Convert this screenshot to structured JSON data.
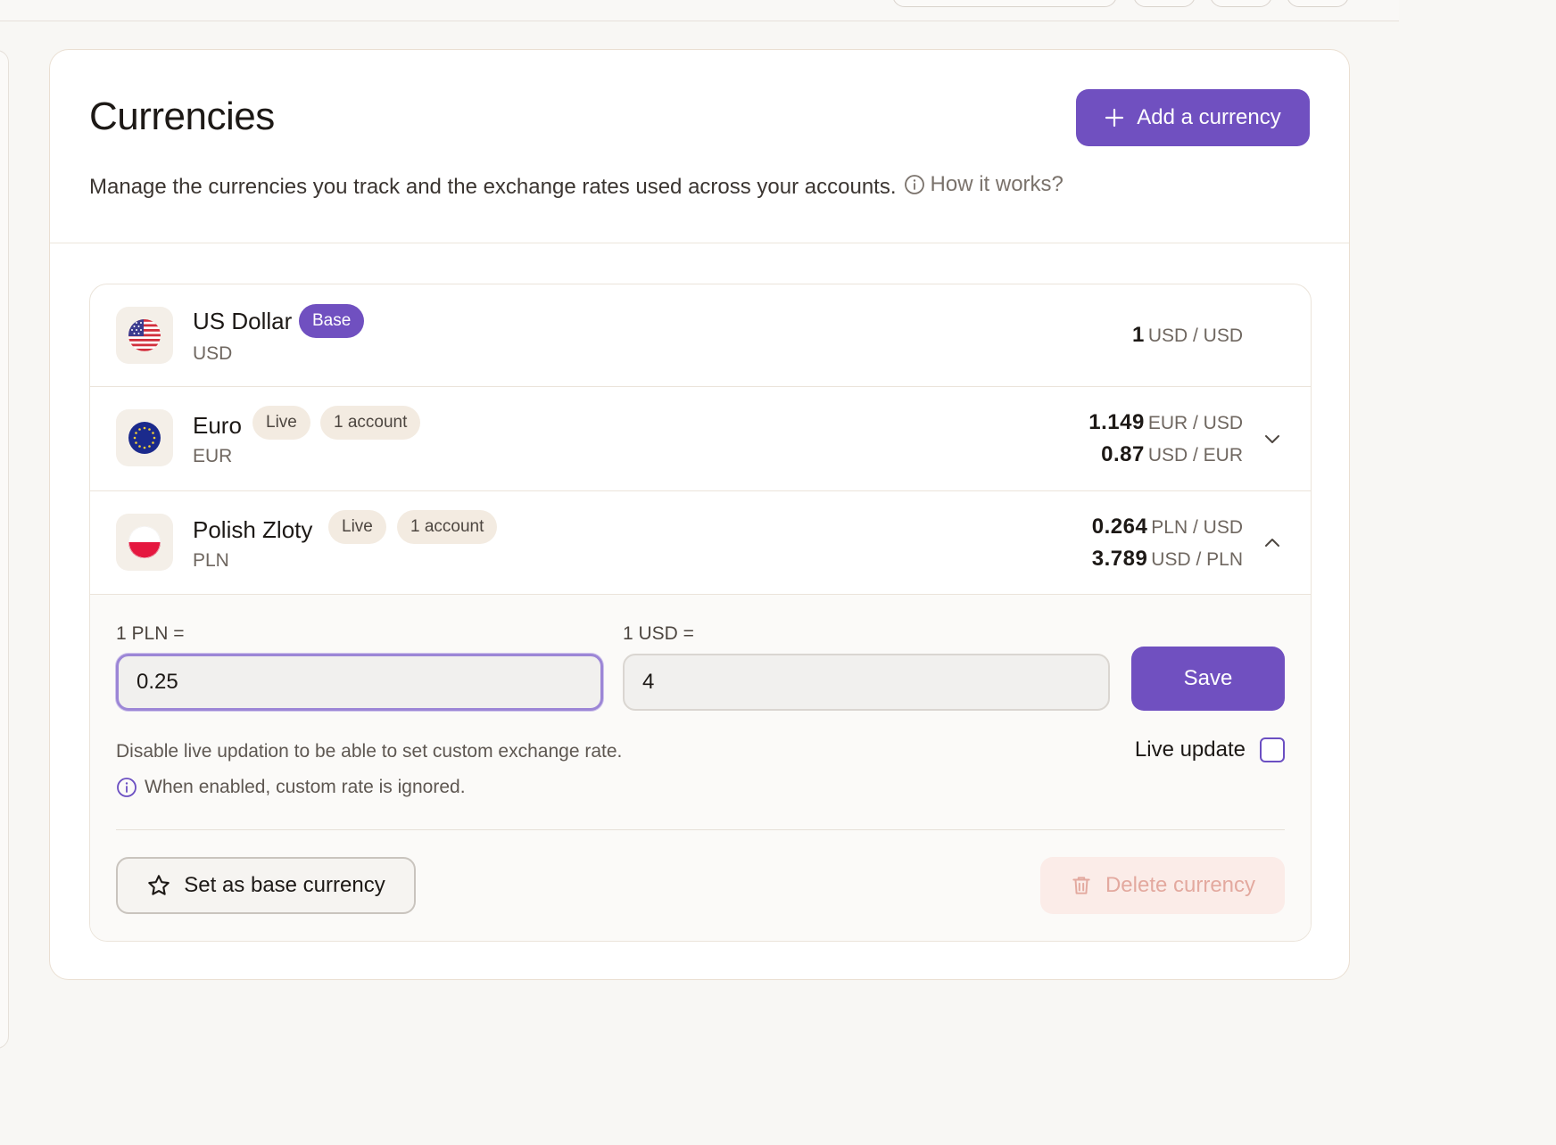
{
  "page": {
    "title": "Currencies",
    "subtitle": "Manage the currencies you track and the exchange rates used across your accounts.",
    "how_it_works": "How it works?",
    "add_button": "Add a currency"
  },
  "currencies": [
    {
      "name": "US Dollar",
      "code": "USD",
      "badge": "Base",
      "flag_icon": "us-flag-icon",
      "rates": [
        {
          "value": "1",
          "unit": "USD / USD"
        }
      ]
    },
    {
      "name": "Euro",
      "code": "EUR",
      "badge": "Live",
      "accounts": "1 account",
      "flag_icon": "eu-flag-icon",
      "rates": [
        {
          "value": "1.149",
          "unit": "EUR / USD"
        },
        {
          "value": "0.87",
          "unit": "USD / EUR"
        }
      ]
    },
    {
      "name": "Polish Zloty",
      "code": "PLN",
      "badge": "Live",
      "accounts": "1 account",
      "flag_icon": "pl-flag-icon",
      "rates": [
        {
          "value": "0.264",
          "unit": "PLN / USD"
        },
        {
          "value": "3.789",
          "unit": "USD / PLN"
        }
      ],
      "expanded": true
    }
  ],
  "editor": {
    "label_a": "1 PLN =",
    "value_a": "0.25",
    "label_b": "1 USD =",
    "value_b": "4",
    "save": "Save",
    "hint": "Disable live updation to be able to set custom exchange rate.",
    "note": "When enabled, custom rate is ignored.",
    "live_update_label": "Live update",
    "live_update_checked": false,
    "set_base": "Set as base currency",
    "delete": "Delete currency"
  },
  "colors": {
    "accent": "#7050c0",
    "badge_neutral": "#f3ebe1",
    "danger_soft": "#fbece8",
    "danger_text": "#e3a99f"
  }
}
